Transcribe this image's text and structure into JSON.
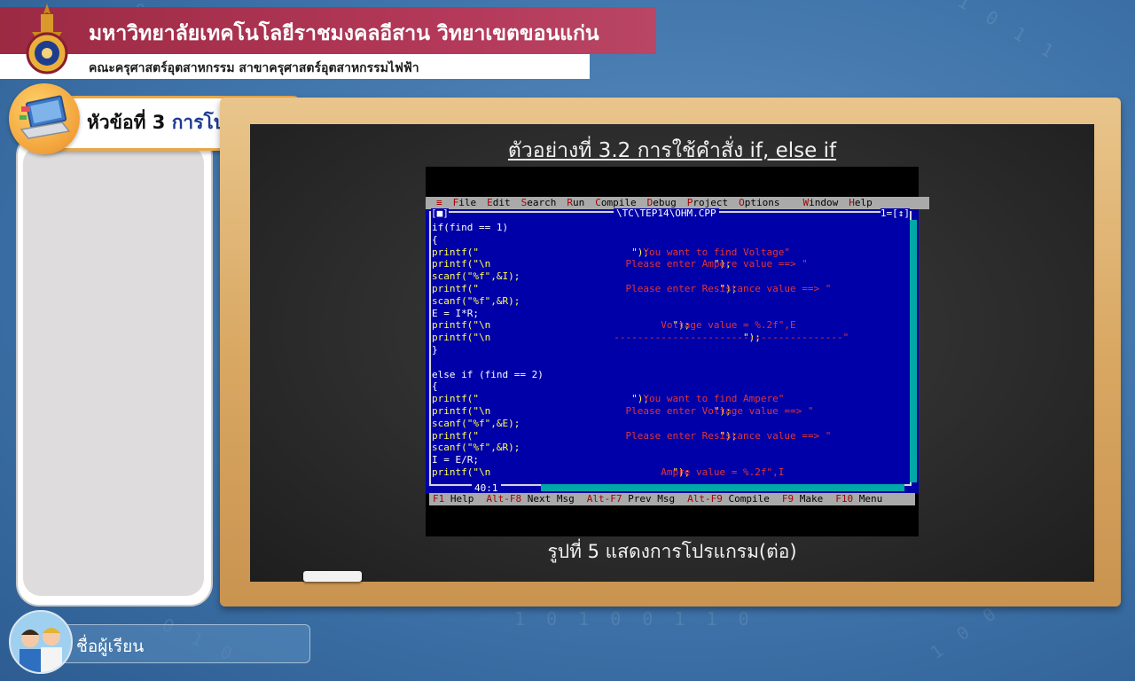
{
  "header": {
    "university": "มหาวิทยาลัยเทคโนโลยีราชมงคลอีสาน วิทยาเขตขอนแก่น",
    "faculty": "คณะครุศาสตร์อุตสาหกรรม สาขาครุศาสตร์อุตสาหกรรมไฟฟ้า"
  },
  "topic": {
    "prefix": "หัวข้อที่ 3",
    "highlight": "การโปรแกรม"
  },
  "board": {
    "title": "ตัวอย่างที่ 3.2 การใช้คำสั่ง if, else if",
    "caption": "รูปที่ 5 แสดงการโปรแกรม(ต่อ)"
  },
  "ide": {
    "menu": [
      {
        "hot": "≡",
        "rest": ""
      },
      {
        "hot": "F",
        "rest": "ile"
      },
      {
        "hot": "E",
        "rest": "dit"
      },
      {
        "hot": "S",
        "rest": "earch"
      },
      {
        "hot": "R",
        "rest": "un"
      },
      {
        "hot": "C",
        "rest": "ompile"
      },
      {
        "hot": "D",
        "rest": "ebug"
      },
      {
        "hot": "P",
        "rest": "roject"
      },
      {
        "hot": "O",
        "rest": "ptions"
      },
      {
        "hot": "W",
        "rest": "indow"
      },
      {
        "hot": "H",
        "rest": "elp"
      }
    ],
    "window_close": "[■]",
    "window_title": "\\TC\\TEP14\\OHM.CPP",
    "window_number": "1=[↕]",
    "cursor_position": "40:1",
    "code": [
      {
        "code": "if(find == 1)",
        "str": "",
        "white": true
      },
      {
        "code": "{",
        "str": "",
        "white": true
      },
      {
        "code": "printf(\"                          \");",
        "str": "                                    You want to find Voltage\"",
        "white": false
      },
      {
        "code": "printf(\"\\n                                      \");",
        "str": "                                 Please enter Ampere value ==> \"",
        "white": false
      },
      {
        "code": "scanf(\"%f\",&I);",
        "str": "",
        "white": false
      },
      {
        "code": "printf(\"                                         \");",
        "str": "                                 Please enter Resistance value ==> \"",
        "white": false
      },
      {
        "code": "scanf(\"%f\",&R);",
        "str": "",
        "white": false
      },
      {
        "code": "E = I*R;",
        "str": "",
        "white": true
      },
      {
        "code": "printf(\"\\n                               \");",
        "str": "                                       Voltage value = %.2f\",E",
        "white": false
      },
      {
        "code": "printf(\"\\n                                           \");",
        "str": "                               ---------------------------------------\"",
        "white": false
      },
      {
        "code": "}",
        "str": "",
        "white": true
      },
      {
        "code": "",
        "str": "",
        "white": true
      },
      {
        "code": "else if (find == 2)",
        "str": "",
        "white": true
      },
      {
        "code": "{",
        "str": "",
        "white": true
      },
      {
        "code": "printf(\"                          \");",
        "str": "                                    You want to find Ampere\"",
        "white": false
      },
      {
        "code": "printf(\"\\n                                      \");",
        "str": "                                 Please enter Voltage value ==> \"",
        "white": false
      },
      {
        "code": "scanf(\"%f\",&E);",
        "str": "",
        "white": false
      },
      {
        "code": "printf(\"                                         \");",
        "str": "                                 Please enter Resistance value ==> \"",
        "white": false
      },
      {
        "code": "scanf(\"%f\",&R);",
        "str": "",
        "white": false
      },
      {
        "code": "I = E/R;",
        "str": "",
        "white": true
      },
      {
        "code": "printf(\"\\n                               \");",
        "str": "                                       Ampre value = %.2f\",I",
        "white": false
      }
    ],
    "status": [
      {
        "key": "F1",
        "label": "Help"
      },
      {
        "key": "Alt-F8",
        "label": "Next Msg"
      },
      {
        "key": "Alt-F7",
        "label": "Prev Msg"
      },
      {
        "key": "Alt-F9",
        "label": "Compile"
      },
      {
        "key": "F9",
        "label": "Make"
      },
      {
        "key": "F10",
        "label": "Menu"
      }
    ]
  },
  "student": {
    "label": "ชื่อผู้เรียน"
  },
  "colors": {
    "header_red": "#b4395a",
    "ide_blue": "#0000a8",
    "frame_wood": "#d9a863",
    "board": "#2b2b2b"
  }
}
